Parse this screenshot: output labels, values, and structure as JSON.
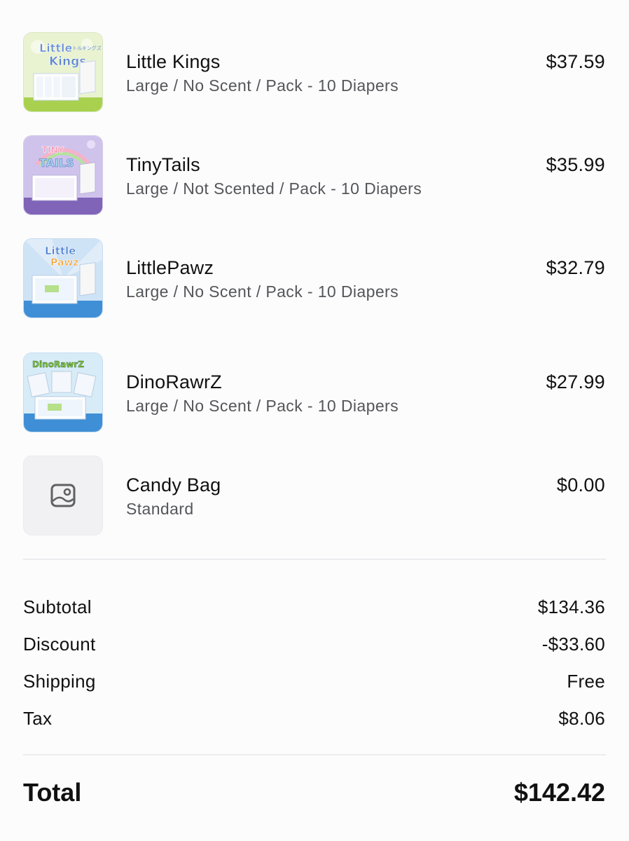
{
  "items": [
    {
      "name": "Little Kings",
      "variant": "Large / No Scent / Pack - 10 Diapers",
      "price": "$37.59",
      "image": {
        "logo_text_1": "Little",
        "logo_text_2": "Kings",
        "logo_text_jp": "リトルキングズ",
        "accent": "#a9d14f",
        "bg": "#e9f3d2"
      }
    },
    {
      "name": "TinyTails",
      "variant": "Large / Not Scented / Pack - 10 Diapers",
      "price": "$35.99",
      "image": {
        "logo_text_1": "TINY",
        "logo_text_2": "TAILS",
        "accent": "#7f64b8",
        "bg": "#cfc3ec"
      }
    },
    {
      "name": "LittlePawz",
      "variant": "Large / No Scent / Pack - 10 Diapers",
      "price": "$32.79",
      "image": {
        "logo_text_1": "Little",
        "logo_text_2": "Pawz",
        "accent": "#3f8fd6",
        "bg": "#cfe3f6"
      }
    },
    {
      "name": "DinoRawrZ",
      "variant": "Large / No Scent / Pack - 10 Diapers",
      "price": "$27.99",
      "image": {
        "logo_text_1": "DinoRawrZ",
        "accent": "#3f8fd6",
        "bg": "#d8ecf7"
      }
    },
    {
      "name": "Candy Bag",
      "variant": "Standard",
      "price": "$0.00",
      "image": {
        "icon": "image-placeholder-icon"
      }
    }
  ],
  "summary": {
    "subtotal_label": "Subtotal",
    "subtotal_value": "$134.36",
    "discount_label": "Discount",
    "discount_value": "-$33.60",
    "shipping_label": "Shipping",
    "shipping_value": "Free",
    "tax_label": "Tax",
    "tax_value": "$8.06"
  },
  "total": {
    "label": "Total",
    "value": "$142.42"
  }
}
